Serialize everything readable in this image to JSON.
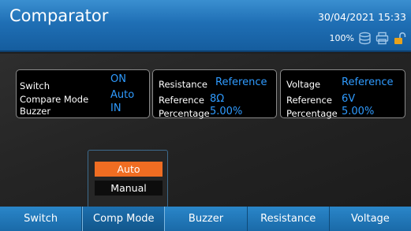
{
  "header": {
    "title": "Comparator",
    "datetime": "30/04/2021 15:33",
    "battery_percent": "100%",
    "icons": [
      "storage-icon",
      "printer-icon",
      "lock-open-icon"
    ]
  },
  "switch_panel": {
    "switch_label": "Switch",
    "switch_value": "ON",
    "mode_label": "Compare Mode",
    "mode_value": "Auto",
    "buzzer_label": "Buzzer",
    "buzzer_value": "IN"
  },
  "resistance_panel": {
    "title_label": "Resistance",
    "title_value": "Reference",
    "reference_label": "Reference",
    "reference_value": "8Ω",
    "percentage_label": "Percentage",
    "percentage_value": "5.00%"
  },
  "voltage_panel": {
    "title_label": "Voltage",
    "title_value": "Reference",
    "reference_label": "Reference",
    "reference_value": "6V",
    "percentage_label": "Percentage",
    "percentage_value": "5.00%"
  },
  "mode_popup": {
    "options": [
      "Auto",
      "Manual"
    ],
    "selected": "Auto"
  },
  "toolbar": {
    "buttons": [
      "Switch",
      "Comp Mode",
      "Buzzer",
      "Resistance",
      "Voltage"
    ],
    "active": "Comp Mode"
  },
  "colors": {
    "header_blue": "#1f6fb5",
    "value_blue": "#2f9bff",
    "selected_orange": "#f06d22"
  }
}
